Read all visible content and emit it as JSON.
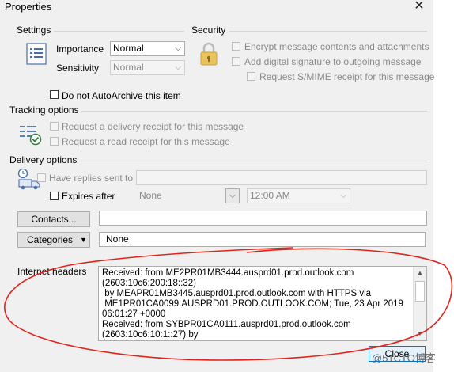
{
  "window": {
    "title": "Properties",
    "close_glyph": "✕"
  },
  "settings": {
    "label": "Settings",
    "importance_label": "Importance",
    "importance_value": "Normal",
    "sensitivity_label": "Sensitivity",
    "sensitivity_value": "Normal",
    "do_not_autoarchive": "Do not AutoArchive this item"
  },
  "security": {
    "label": "Security",
    "encrypt": "Encrypt message contents and attachments",
    "digital_signature": "Add digital signature to outgoing message",
    "smime_receipt": "Request S/MIME receipt for this message"
  },
  "tracking": {
    "label": "Tracking options",
    "delivery_receipt": "Request a delivery receipt for this message",
    "read_receipt": "Request a read receipt for this message"
  },
  "delivery": {
    "label": "Delivery options",
    "have_replies_sent_to": "Have replies sent to",
    "expires_after": "Expires after",
    "expires_date": "None",
    "expires_time": "12:00 AM"
  },
  "contacts_button": "Contacts...",
  "categories_button": "Categories",
  "categories_value": "None",
  "internet_headers": {
    "label": "Internet headers",
    "text": "Received: from ME2PR01MB3444.ausprd01.prod.outlook.com\n(2603:10c6:200:18::32)\n by MEAPR01MB3445.ausprd01.prod.outlook.com with HTTPS via\n ME1PR01CA0099.AUSPRD01.PROD.OUTLOOK.COM; Tue, 23 Apr 2019\n06:01:27 +0000\nReceived: from SYBPR01CA0111.ausprd01.prod.outlook.com\n(2603:10c6:10:1::27) by"
  },
  "close_button": "Close",
  "watermark": "@51CTO博客"
}
